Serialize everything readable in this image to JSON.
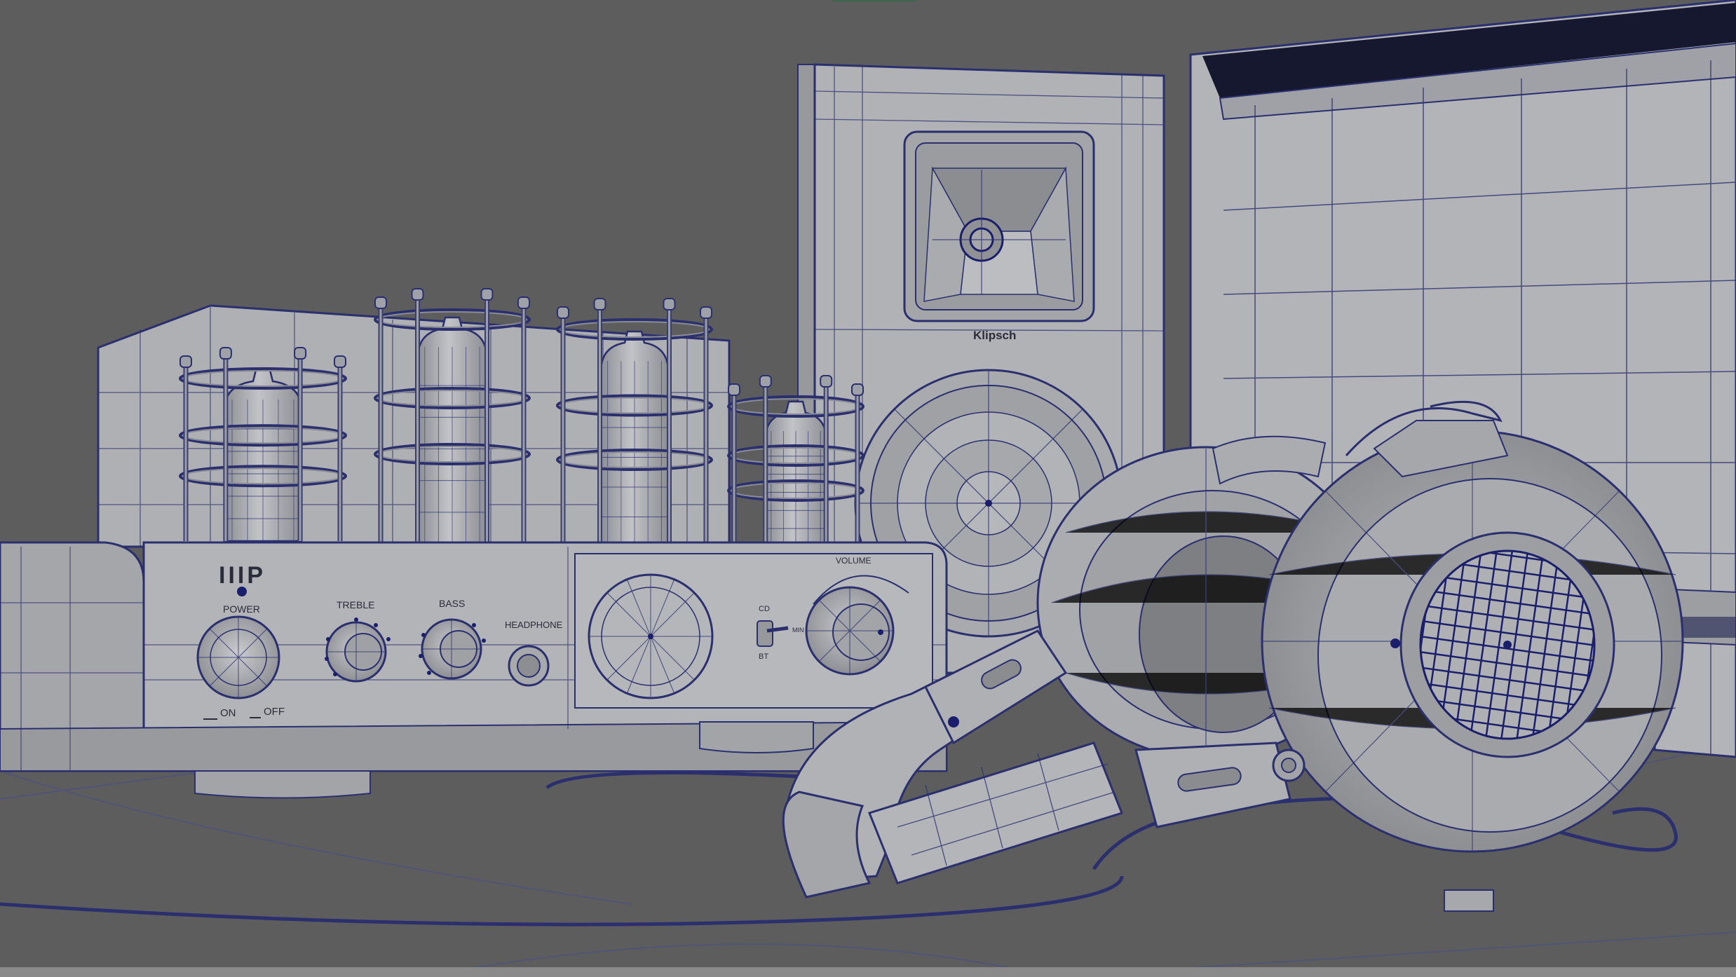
{
  "amplifier": {
    "logo": "IIIP",
    "power_label": "POWER",
    "treble_label": "TREBLE",
    "bass_label": "BASS",
    "headphone_label": "HEADPHONE",
    "volume_label": "VOLUME",
    "on_label": "ON",
    "off_label": "OFF",
    "cd_label": "CD",
    "bt_label": "BT",
    "min_label": "MIN"
  },
  "speaker": {
    "brand": "Klipsch"
  },
  "colors": {
    "background": "#5d5d5d",
    "wireframe": "#2b2f6e",
    "surface": "#aeb0b4",
    "accent": "#1f6b3f"
  }
}
